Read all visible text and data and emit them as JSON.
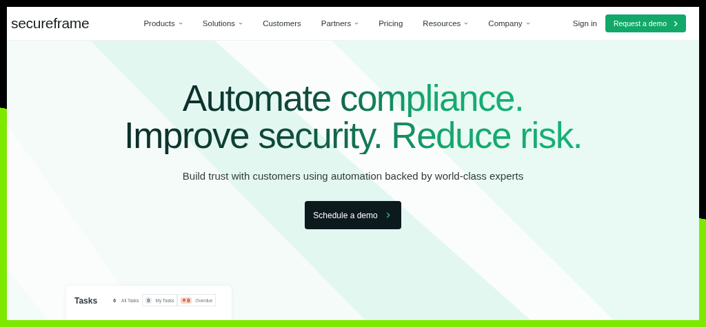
{
  "brand": "secureframe",
  "nav": [
    {
      "label": "Products",
      "has_menu": true
    },
    {
      "label": "Solutions",
      "has_menu": true
    },
    {
      "label": "Customers",
      "has_menu": false
    },
    {
      "label": "Partners",
      "has_menu": true
    },
    {
      "label": "Pricing",
      "has_menu": false
    },
    {
      "label": "Resources",
      "has_menu": true
    },
    {
      "label": "Company",
      "has_menu": true
    }
  ],
  "sign_in": "Sign in",
  "cta": "Request a demo",
  "headline": [
    "Automate compliance.",
    "Improve security. Reduce risk."
  ],
  "subtitle": "Build trust with customers using automation backed by world-class experts",
  "hero_button": "Schedule a demo",
  "tasks": {
    "title": "Tasks",
    "filters": [
      {
        "count": "6",
        "label": "All Tasks",
        "kind": "plain"
      },
      {
        "count": "0",
        "label": "My Tasks",
        "kind": "grey"
      },
      {
        "count": "0",
        "label": "Overdue",
        "kind": "alert"
      }
    ]
  }
}
